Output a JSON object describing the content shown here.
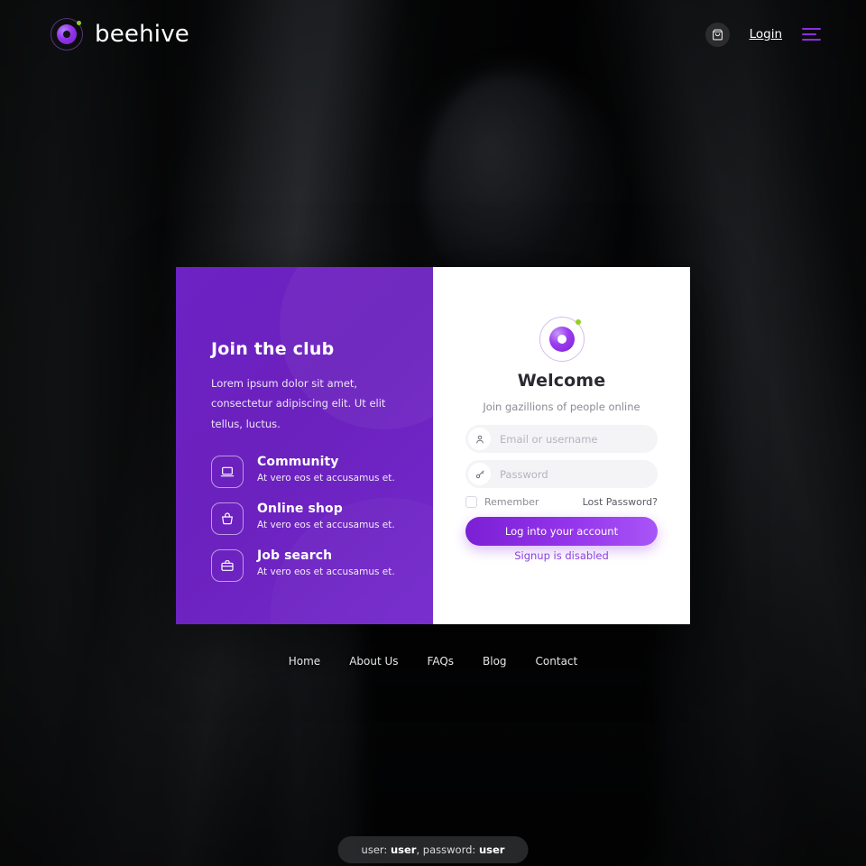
{
  "header": {
    "brand_name": "beehive",
    "cart_icon": "shopping-bag-icon",
    "login_label": "Login",
    "menu_icon": "hamburger-menu-icon"
  },
  "card": {
    "left_panel": {
      "title": "Join the club",
      "description": "Lorem ipsum dolor sit amet, consectetur adipiscing elit. Ut elit tellus, luctus.",
      "features": [
        {
          "icon": "laptop-icon",
          "title": "Community",
          "subtitle": "At vero eos et accusamus et."
        },
        {
          "icon": "basket-icon",
          "title": "Online shop",
          "subtitle": "At vero eos et accusamus et."
        },
        {
          "icon": "briefcase-icon",
          "title": "Job search",
          "subtitle": "At vero eos et accusamus et."
        }
      ]
    },
    "right_panel": {
      "logo_icon": "beehive-logo-icon",
      "heading": "Welcome",
      "subtitle": "Join gazillions of people online",
      "email": {
        "icon": "person-icon",
        "placeholder": "Email or username",
        "value": ""
      },
      "password": {
        "icon": "key-icon",
        "placeholder": "Password",
        "value": ""
      },
      "remember_label": "Remember",
      "remember_checked": false,
      "lost_password_label": "Lost Password?",
      "submit_label": "Log into your account",
      "signup_note": "Signup is disabled"
    }
  },
  "footer_nav": [
    {
      "label": "Home"
    },
    {
      "label": "About Us"
    },
    {
      "label": "FAQs"
    },
    {
      "label": "Blog"
    },
    {
      "label": "Contact"
    }
  ],
  "credentials": {
    "user_prefix": "user: ",
    "user_value": "user",
    "password_prefix": ", password: ",
    "password_value": "user"
  },
  "colors": {
    "brand_purple": "#7127c9",
    "accent_violet": "#9333ea",
    "accent_green": "#93d023",
    "panel_white": "#ffffff",
    "page_dark": "#070708"
  }
}
